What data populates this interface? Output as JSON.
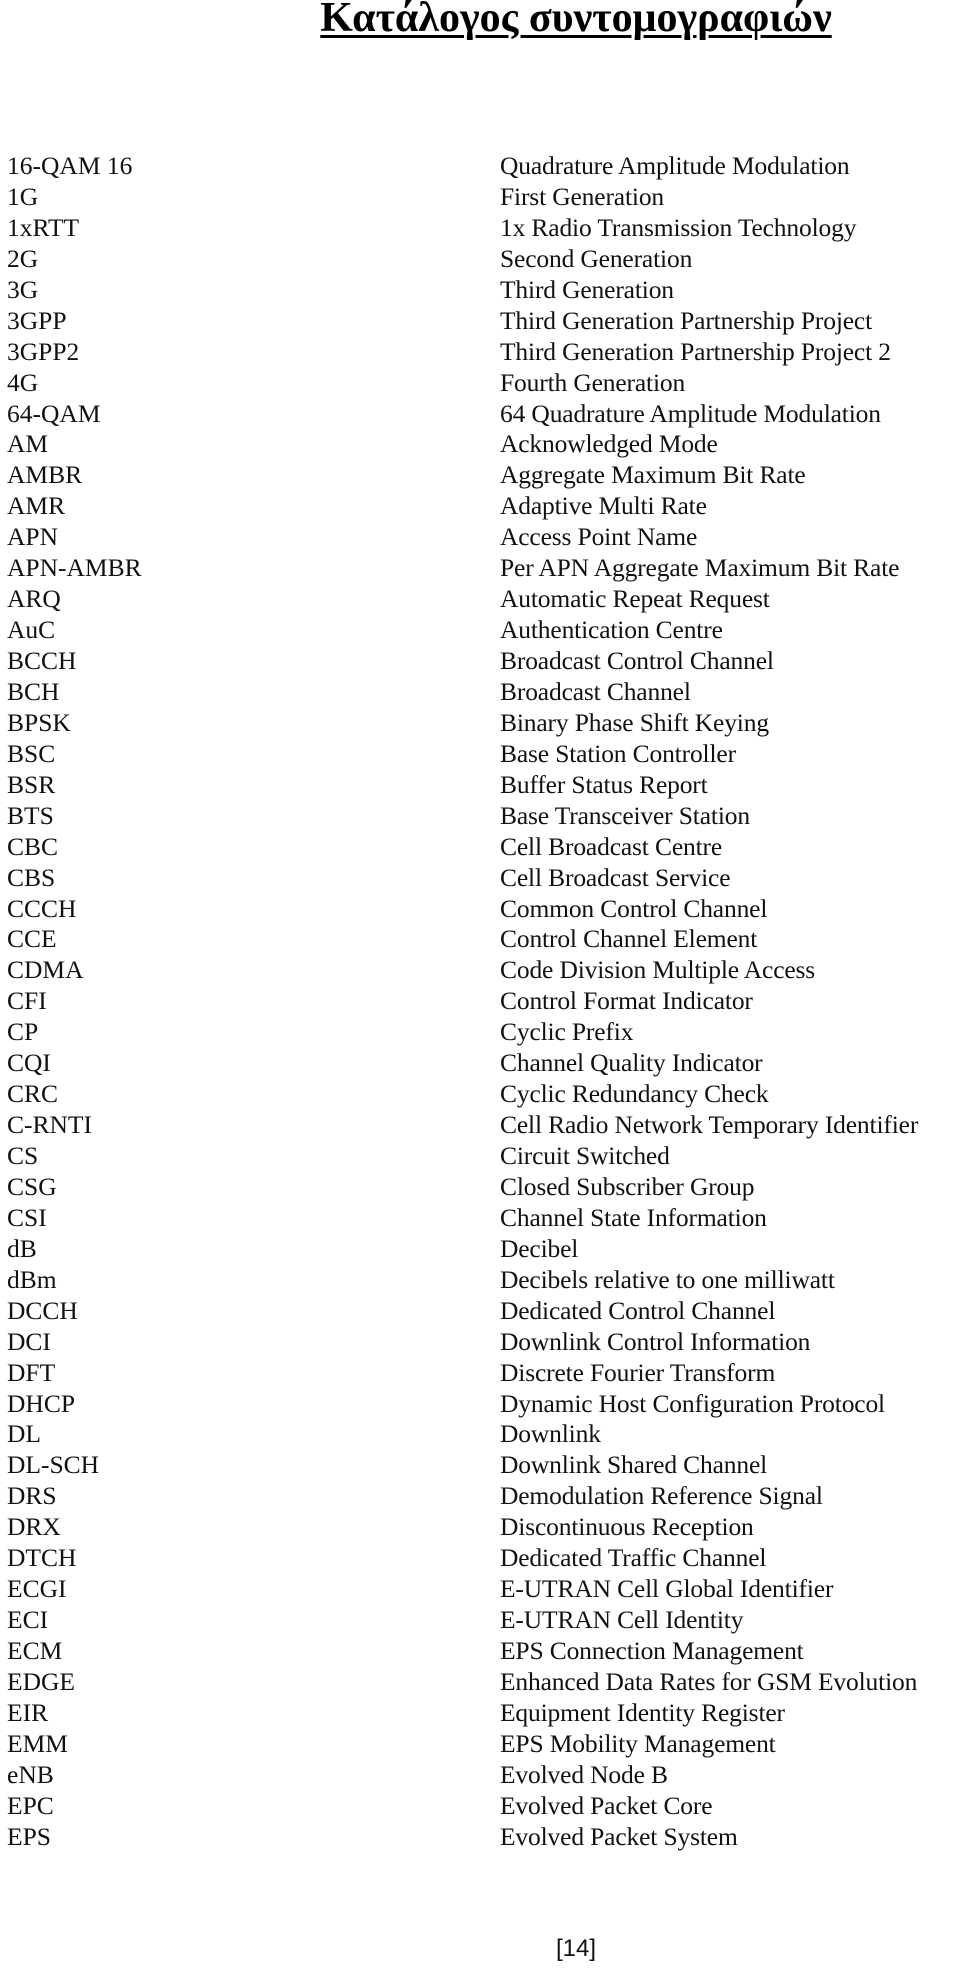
{
  "document": {
    "title": "Κατάλογος συντομογραφιών",
    "page_number": "[14]"
  },
  "abbreviations": [
    {
      "term": "16-QAM 16",
      "definition": "Quadrature Amplitude Modulation"
    },
    {
      "term": "1G",
      "definition": "First Generation"
    },
    {
      "term": "1xRTT",
      "definition": "1x Radio Transmission Technology"
    },
    {
      "term": "2G",
      "definition": "Second Generation"
    },
    {
      "term": "3G",
      "definition": "Third Generation"
    },
    {
      "term": "3GPP",
      "definition": "Third Generation Partnership Project"
    },
    {
      "term": "3GPP2",
      "definition": "Third Generation Partnership Project 2"
    },
    {
      "term": "4G",
      "definition": "Fourth Generation"
    },
    {
      "term": "64-QAM",
      "definition": "64 Quadrature Amplitude Modulation"
    },
    {
      "term": "AM",
      "definition": "Acknowledged Mode"
    },
    {
      "term": "AMBR",
      "definition": "Aggregate Maximum Bit Rate"
    },
    {
      "term": "AMR",
      "definition": "Adaptive Multi Rate"
    },
    {
      "term": "APN",
      "definition": "Access Point Name"
    },
    {
      "term": "APN-AMBR",
      "definition": "Per APN Aggregate Maximum Bit Rate"
    },
    {
      "term": "ARQ",
      "definition": "Automatic Repeat Request"
    },
    {
      "term": "AuC",
      "definition": "Authentication Centre"
    },
    {
      "term": "BCCH",
      "definition": "Broadcast Control Channel"
    },
    {
      "term": "BCH",
      "definition": "Broadcast Channel"
    },
    {
      "term": "BPSK",
      "definition": "Binary Phase Shift Keying"
    },
    {
      "term": "BSC",
      "definition": "Base Station Controller"
    },
    {
      "term": "BSR",
      "definition": "Buffer Status Report"
    },
    {
      "term": "BTS",
      "definition": "Base Transceiver Station"
    },
    {
      "term": "CBC",
      "definition": "Cell Broadcast Centre"
    },
    {
      "term": "CBS",
      "definition": "Cell Broadcast Service"
    },
    {
      "term": "CCCH",
      "definition": "Common Control Channel"
    },
    {
      "term": "CCE",
      "definition": "Control Channel Element"
    },
    {
      "term": "CDMA",
      "definition": "Code Division Multiple Access"
    },
    {
      "term": "CFI",
      "definition": "Control Format Indicator"
    },
    {
      "term": "CP",
      "definition": "Cyclic Prefix"
    },
    {
      "term": "CQI",
      "definition": "Channel Quality Indicator"
    },
    {
      "term": "CRC",
      "definition": "Cyclic Redundancy Check"
    },
    {
      "term": "C-RNTI",
      "definition": "Cell Radio Network Temporary Identifier"
    },
    {
      "term": "CS",
      "definition": "Circuit Switched"
    },
    {
      "term": "CSG",
      "definition": "Closed Subscriber Group"
    },
    {
      "term": "CSI",
      "definition": "Channel State Information"
    },
    {
      "term": "dB",
      "definition": "Decibel"
    },
    {
      "term": "dBm",
      "definition": "Decibels relative to one milliwatt"
    },
    {
      "term": "DCCH",
      "definition": "Dedicated Control Channel"
    },
    {
      "term": "DCI",
      "definition": "Downlink Control Information"
    },
    {
      "term": "DFT",
      "definition": "Discrete Fourier Transform"
    },
    {
      "term": "DHCP",
      "definition": "Dynamic Host Configuration Protocol"
    },
    {
      "term": "DL",
      "definition": "Downlink"
    },
    {
      "term": "DL-SCH",
      "definition": "Downlink Shared Channel"
    },
    {
      "term": "DRS",
      "definition": "Demodulation Reference Signal"
    },
    {
      "term": "DRX",
      "definition": "Discontinuous Reception"
    },
    {
      "term": "DTCH",
      "definition": "Dedicated Traffic Channel"
    },
    {
      "term": "ECGI",
      "definition": "E-UTRAN Cell Global Identifier"
    },
    {
      "term": "ECI",
      "definition": "E-UTRAN Cell Identity"
    },
    {
      "term": "ECM",
      "definition": "EPS Connection Management"
    },
    {
      "term": "EDGE",
      "definition": "Enhanced Data Rates for GSM Evolution"
    },
    {
      "term": "EIR",
      "definition": "Equipment Identity Register"
    },
    {
      "term": "EMM",
      "definition": "EPS Mobility Management"
    },
    {
      "term": "eNB",
      "definition": "Evolved Node B"
    },
    {
      "term": "EPC",
      "definition": "Evolved Packet Core"
    },
    {
      "term": "EPS",
      "definition": "Evolved Packet System"
    }
  ]
}
